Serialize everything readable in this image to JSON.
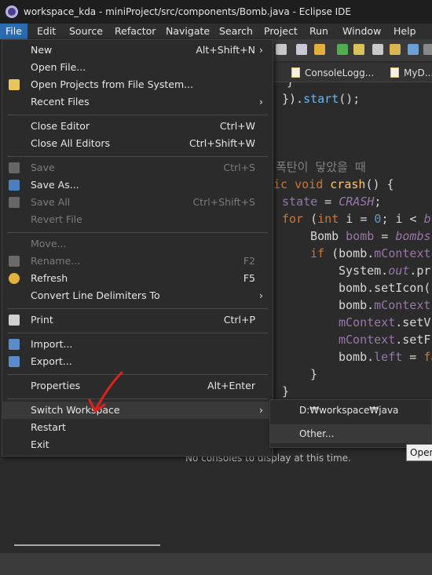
{
  "window": {
    "title": "workspace_kda - miniProject/src/components/Bomb.java - Eclipse IDE"
  },
  "menubar": [
    {
      "label": "File",
      "active": true
    },
    {
      "label": "Edit"
    },
    {
      "label": "Source"
    },
    {
      "label": "Refactor"
    },
    {
      "label": "Navigate"
    },
    {
      "label": "Search"
    },
    {
      "label": "Project"
    },
    {
      "label": "Run"
    },
    {
      "label": "Window"
    },
    {
      "label": "Help"
    }
  ],
  "tabs": [
    {
      "label": "ConsoleLogg..."
    },
    {
      "label": "MyD..."
    }
  ],
  "file_menu": {
    "items": [
      {
        "label": "New",
        "shortcut": "Alt+Shift+N",
        "submenu": true,
        "enabled": true
      },
      {
        "label": "Open File...",
        "enabled": true
      },
      {
        "label": "Open Projects from File System...",
        "enabled": true,
        "icon": "folder-icon"
      },
      {
        "label": "Recent Files",
        "submenu": true,
        "enabled": true
      },
      {
        "label": "Close Editor",
        "shortcut": "Ctrl+W",
        "enabled": true
      },
      {
        "label": "Close All Editors",
        "shortcut": "Ctrl+Shift+W",
        "enabled": true
      },
      {
        "label": "Save",
        "shortcut": "Ctrl+S",
        "enabled": false,
        "icon": "save-icon"
      },
      {
        "label": "Save As...",
        "enabled": true,
        "icon": "save-as-icon"
      },
      {
        "label": "Save All",
        "shortcut": "Ctrl+Shift+S",
        "enabled": false,
        "icon": "save-all-icon"
      },
      {
        "label": "Revert File",
        "enabled": false
      },
      {
        "label": "Move...",
        "enabled": false
      },
      {
        "label": "Rename...",
        "shortcut": "F2",
        "enabled": false,
        "icon": "rename-icon"
      },
      {
        "label": "Refresh",
        "shortcut": "F5",
        "enabled": true,
        "icon": "refresh-icon"
      },
      {
        "label": "Convert Line Delimiters To",
        "submenu": true,
        "enabled": true
      },
      {
        "label": "Print",
        "shortcut": "Ctrl+P",
        "enabled": true,
        "icon": "print-icon"
      },
      {
        "label": "Import...",
        "enabled": true,
        "icon": "import-icon"
      },
      {
        "label": "Export...",
        "enabled": true,
        "icon": "export-icon"
      },
      {
        "label": "Properties",
        "shortcut": "Alt+Enter",
        "enabled": true
      },
      {
        "label": "Switch Workspace",
        "submenu": true,
        "enabled": true,
        "highlighted": true
      },
      {
        "label": "Restart",
        "enabled": true
      },
      {
        "label": "Exit",
        "enabled": true
      }
    ]
  },
  "switch_workspace_submenu": [
    {
      "label": "D:₩workspace₩java"
    },
    {
      "label": "Other..."
    }
  ],
  "tooltip": {
    "text": "Open"
  },
  "console": {
    "message": "No consoles to display at this time."
  },
  "editor": {
    "comment": "폭탄이 닿았을 때"
  },
  "colors": {
    "menu_highlight": "#2b6bb1",
    "annotation_arrow": "#e0201a"
  }
}
